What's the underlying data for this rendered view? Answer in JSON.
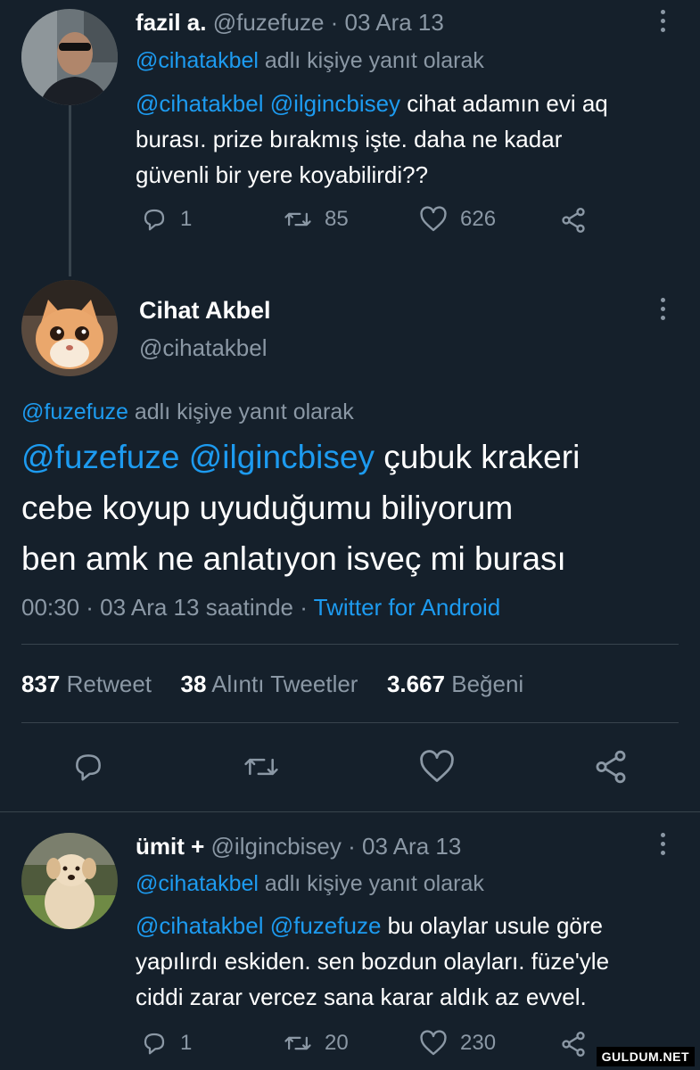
{
  "tweet1": {
    "name": "fazil a.",
    "handle": "@fuzefuze",
    "date": "· 03 Ara 13",
    "reply_to_handle": "@cihatakbel",
    "reply_to_suffix": " adlı kişiye yanıt olarak",
    "mention1": "@cihatakbel",
    "mention2": "@ilgincbisey",
    "text_line1": " cihat adamın evi aq",
    "text_line2": "burası. prize bırakmış işte. daha ne kadar",
    "text_line3": "güvenli bir yere koyabilirdi??",
    "replies": "1",
    "retweets": "85",
    "likes": "626"
  },
  "main": {
    "name": "Cihat Akbel",
    "handle": "@cihatakbel",
    "reply_to_handle": "@fuzefuze",
    "reply_to_suffix": " adlı kişiye yanıt olarak",
    "mention1": "@fuzefuze",
    "mention2": "@ilgincbisey",
    "text_line1": " çubuk krakeri",
    "text_line2": "cebe koyup uyuduğumu biliyorum",
    "text_line3": "ben amk ne anlatıyon isveç mi burası",
    "time": "00:30 · 03 Ara 13 saatinde · ",
    "source": "Twitter for Android",
    "retweet_count": "837",
    "retweet_label": "Retweet",
    "quote_count": "38",
    "quote_label": "Alıntı Tweetler",
    "like_count": "3.667",
    "like_label": "Beğeni"
  },
  "tweet3": {
    "name": "ümit +",
    "handle": "@ilgincbisey",
    "date": "· 03 Ara 13",
    "reply_to_handle": "@cihatakbel",
    "reply_to_suffix": " adlı kişiye yanıt olarak",
    "mention1": "@cihatakbel",
    "mention2": "@fuzefuze",
    "text_line1": " bu olaylar usule göre",
    "text_line2": "yapılırdı eskiden. sen bozdun olayları. füze'yle",
    "text_line3": "ciddi zarar vercez sana karar aldık az evvel.",
    "replies": "1",
    "retweets": "20",
    "likes": "230"
  },
  "watermark": "GULDUM.NET",
  "colors": {
    "background": "#15202b",
    "link": "#1d9bf0",
    "muted": "#8b98a5",
    "divider": "#38444d"
  }
}
